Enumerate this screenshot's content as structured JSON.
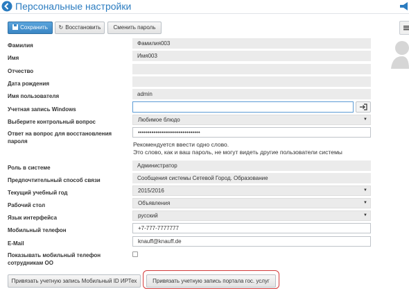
{
  "header": {
    "title": "Персональные настройки"
  },
  "toolbar": {
    "save_label": "Сохранить",
    "restore_label": "Восстановить",
    "change_password_label": "Сменить пароль"
  },
  "form": {
    "last_name": {
      "label": "Фамилия",
      "value": "Фамилия003"
    },
    "first_name": {
      "label": "Имя",
      "value": "Имя003"
    },
    "middle_name": {
      "label": "Отчество",
      "value": ""
    },
    "birth_date": {
      "label": "Дата рождения",
      "value": ""
    },
    "username": {
      "label": "Имя пользователя",
      "value": "admin"
    },
    "windows_account": {
      "label": "Учетная запись Windows",
      "value": ""
    },
    "security_question": {
      "label": "Выберите контрольный вопрос",
      "value": "Любимое блюдо"
    },
    "security_answer": {
      "label_line1": "Ответ на вопрос для восстановления",
      "label_line2": "пароля",
      "value": "••••••••••••••••••••••••••••••••"
    },
    "hint_line1": "Рекомендуется ввести одно слово.",
    "hint_line2": "Это слово, как и ваш пароль, не могут видеть другие пользователи системы",
    "role": {
      "label": "Роль в системе",
      "value": "Администратор"
    },
    "contact_method": {
      "label": "Предпочтительный способ связи",
      "value": "Сообщения системы Сетевой Город. Образование"
    },
    "school_year": {
      "label": "Текущий учебный год",
      "value": "2015/2016"
    },
    "desktop": {
      "label": "Рабочий стол",
      "value": "Объявления"
    },
    "language": {
      "label": "Язык интерфейса",
      "value": "русский"
    },
    "mobile_phone": {
      "label": "Мобильный телефон",
      "value": "+7-777-7777777"
    },
    "email": {
      "label": "E-Mail",
      "value": "knauff@knauff.de"
    },
    "show_phone": {
      "label_line1": "Показывать мобильный телефон",
      "label_line2": "сотрудникам ОО",
      "checked": false
    }
  },
  "bottom": {
    "bind_mobile_id_label": "Привязать учетную запись Мобильный ID ИРТех",
    "bind_gosuslugi_label": "Привязать учетную запись портала гос. услуг"
  },
  "colors": {
    "accent": "#2b7cc0",
    "primary_button": "#3a86c4",
    "highlight": "#d23a3a"
  },
  "icons": [
    "back-icon",
    "save-icon",
    "refresh-icon",
    "megaphone-icon",
    "menu-icon",
    "avatar-icon",
    "login-icon",
    "caret-down-icon"
  ]
}
